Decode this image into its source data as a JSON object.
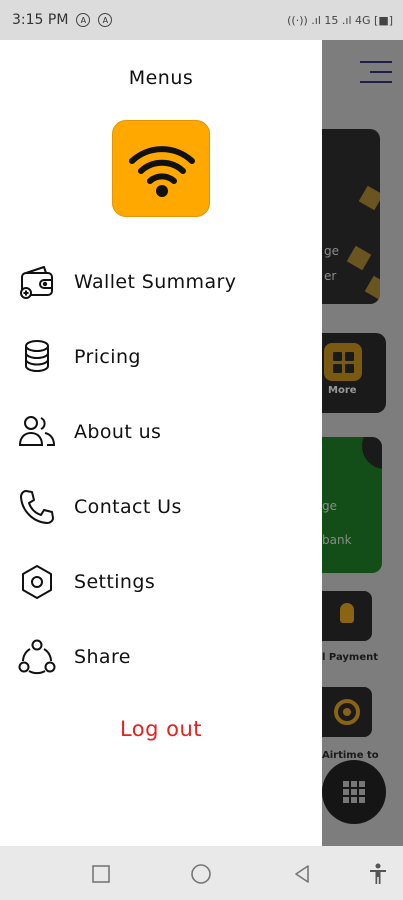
{
  "status_bar": {
    "time": "3:15 PM",
    "indicators": [
      "A",
      "A"
    ],
    "right_text": "((·)) .ıl 15 .ıl 4G [■]"
  },
  "drawer": {
    "title": "Menus",
    "logo_icon": "wifi-icon",
    "items": [
      {
        "label": "Wallet Summary",
        "icon": "wallet-icon"
      },
      {
        "label": "Pricing",
        "icon": "coins-icon"
      },
      {
        "label": "About us",
        "icon": "users-icon"
      },
      {
        "label": "Contact Us",
        "icon": "phone-icon"
      },
      {
        "label": "Settings",
        "icon": "gear-icon"
      },
      {
        "label": "Share",
        "icon": "share-icon"
      }
    ],
    "logout_label": "Log out"
  },
  "background": {
    "card1_lines": [
      "ge",
      "er"
    ],
    "more_label": "More",
    "card3_lines": [
      "ge",
      "bank"
    ],
    "tile1_label": "l Payment",
    "tile2_label": "Airtime to"
  },
  "colors": {
    "accent": "#ffa800",
    "logout": "#e3231f"
  },
  "nav_bar": {
    "buttons": [
      "recent-apps-icon",
      "home-icon",
      "back-icon",
      "accessibility-icon"
    ]
  }
}
